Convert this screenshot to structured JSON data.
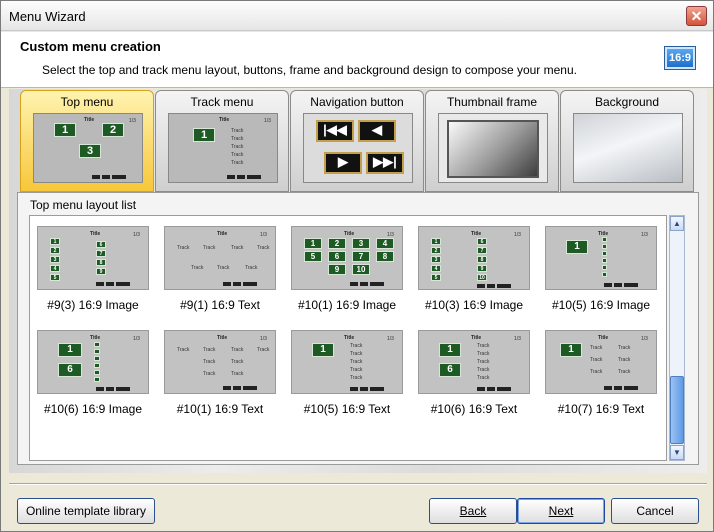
{
  "window": {
    "title": "Menu Wizard",
    "close_icon": "✕"
  },
  "header": {
    "title": "Custom menu creation",
    "subtitle": "Select the top and track menu layout, buttons, frame and background design to compose your menu.",
    "aspect_badge": "16:9"
  },
  "tabs": [
    {
      "label": "Top menu",
      "active": true
    },
    {
      "label": "Track menu",
      "active": false
    },
    {
      "label": "Navigation button",
      "active": false
    },
    {
      "label": "Thumbnail frame",
      "active": false
    },
    {
      "label": "Background",
      "active": false
    }
  ],
  "preview_text": {
    "title": "Title",
    "track": "Track",
    "page": "1/3"
  },
  "nav_buttons": [
    "|◀◀",
    "◀",
    "▶",
    "▶▶|"
  ],
  "panel": {
    "label": "Top menu layout list"
  },
  "layouts": [
    {
      "label": "#9(3) 16:9 Image"
    },
    {
      "label": "#9(1) 16:9 Text"
    },
    {
      "label": "#10(1) 16:9 Image"
    },
    {
      "label": "#10(3) 16:9 Image"
    },
    {
      "label": "#10(5) 16:9 Image"
    },
    {
      "label": "#10(6) 16:9 Image"
    },
    {
      "label": "#10(1) 16:9 Text"
    },
    {
      "label": "#10(5) 16:9 Text"
    },
    {
      "label": "#10(6) 16:9 Text"
    },
    {
      "label": "#10(7) 16:9 Text"
    }
  ],
  "scrollbar": {
    "up_icon": "▲",
    "down_icon": "▼"
  },
  "footer": {
    "online_library": "Online template library",
    "back": "Back",
    "next": "Next",
    "cancel": "Cancel"
  }
}
